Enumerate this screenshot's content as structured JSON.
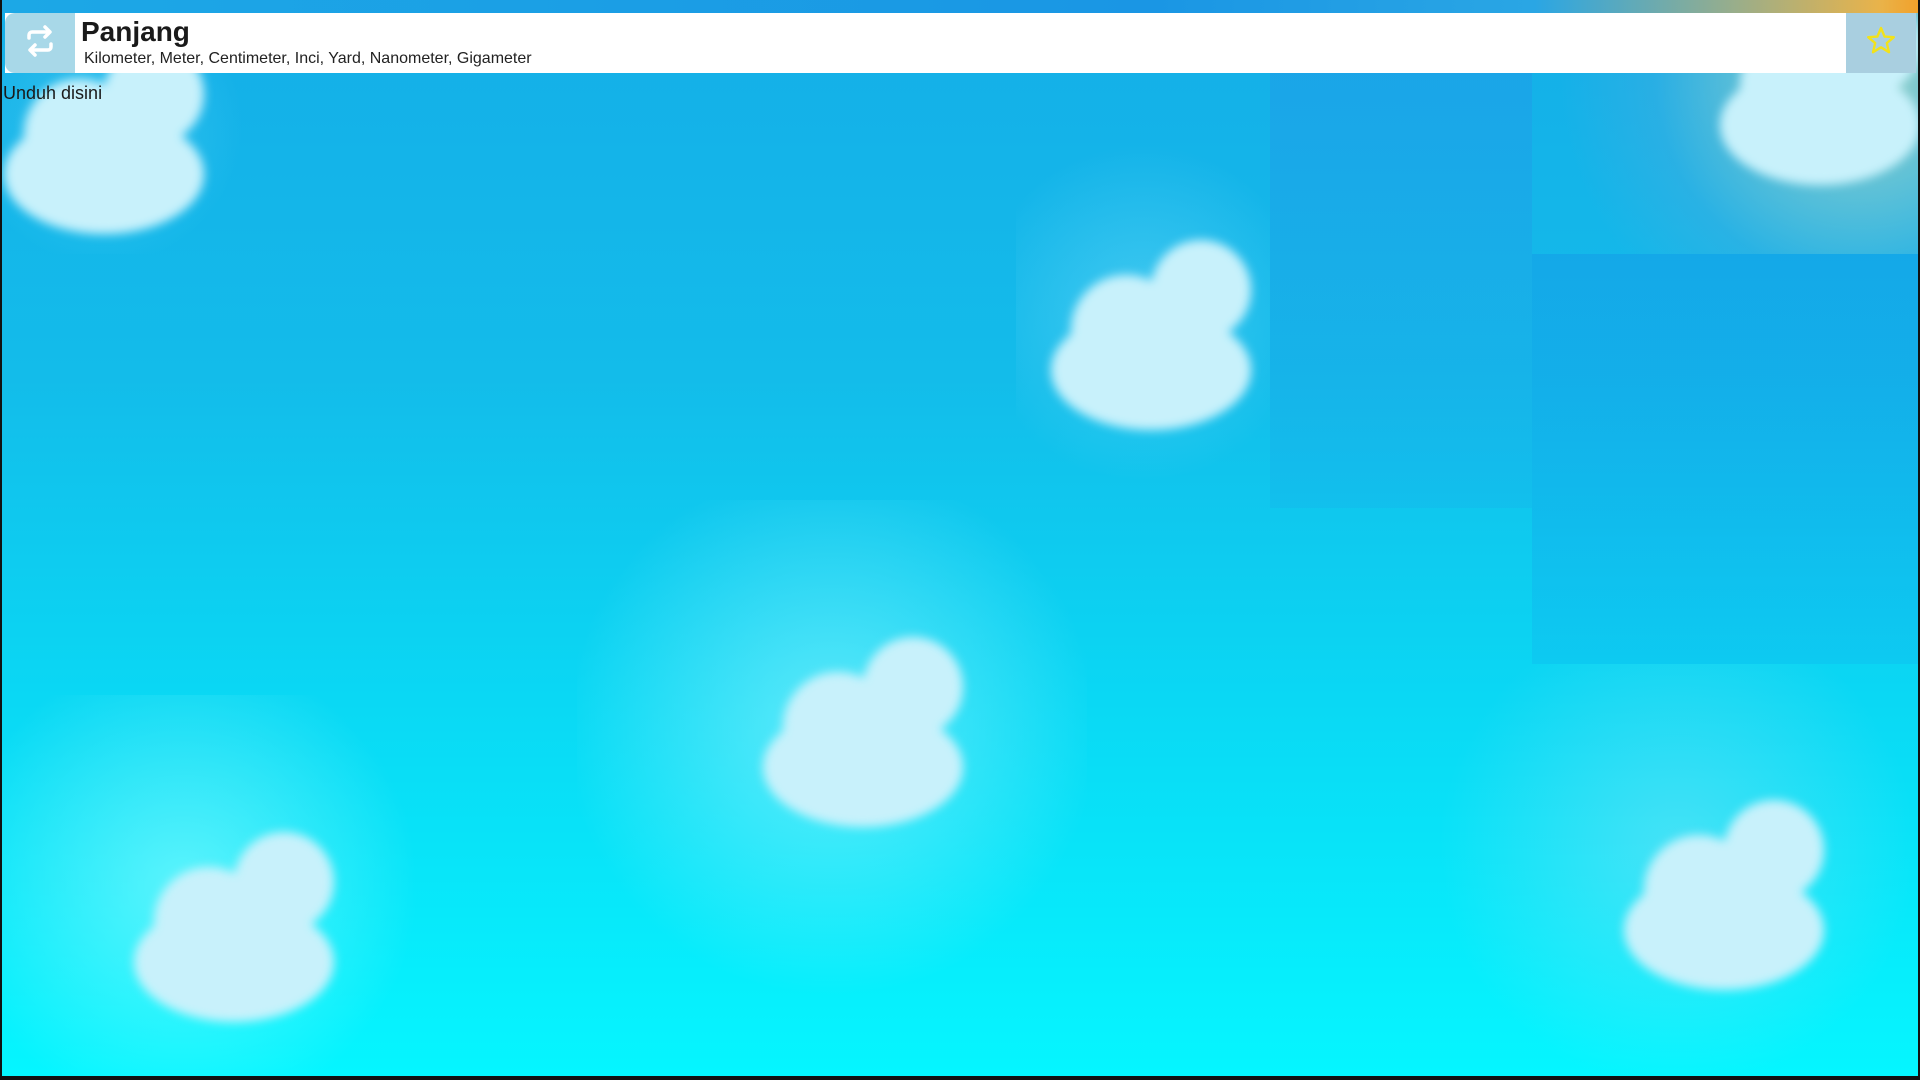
{
  "header": {
    "title": "Panjang",
    "subtitle": "Kilometer, Meter, Centimeter, Inci, Yard, Nanometer, Gigameter",
    "refresh_icon": "refresh-icon",
    "favorite_icon": "star-icon"
  },
  "download": {
    "label": "Unduh disini"
  },
  "colors": {
    "sky_top": "#15aee8",
    "sky_bottom": "#05f6ff",
    "cloud": "#c8f1fb",
    "star": "#f2e21a",
    "header_bg": "#ffffff",
    "button_bg": "#a8d8e8"
  }
}
